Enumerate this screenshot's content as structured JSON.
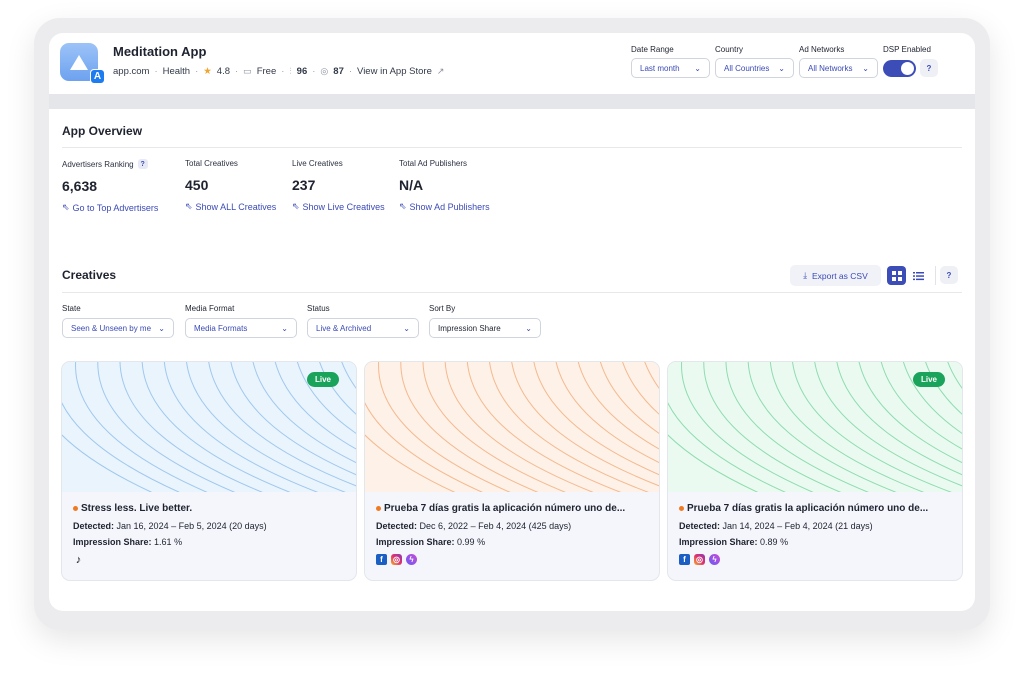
{
  "app": {
    "name": "Meditation App",
    "domain": "app.com",
    "category": "Health",
    "rating": "4.8",
    "price": "Free",
    "stat1": "96",
    "stat2": "87",
    "store_link": "View in App Store"
  },
  "header_filters": {
    "date_range": {
      "label": "Date Range",
      "value": "Last month"
    },
    "country": {
      "label": "Country",
      "value": "All Countries"
    },
    "ad_networks": {
      "label": "Ad Networks",
      "value": "All Networks"
    },
    "dsp": {
      "label": "DSP Enabled",
      "enabled": true,
      "help": "?"
    }
  },
  "overview": {
    "title": "App Overview",
    "stats": [
      {
        "label": "Advertisers Ranking",
        "value": "6,638",
        "link": "Go to Top Advertisers",
        "help": "?"
      },
      {
        "label": "Total Creatives",
        "value": "450",
        "link": "Show ALL Creatives"
      },
      {
        "label": "Live Creatives",
        "value": "237",
        "link": "Show Live Creatives"
      },
      {
        "label": "Total Ad Publishers",
        "value": "N/A",
        "link": "Show Ad Publishers"
      }
    ]
  },
  "creatives": {
    "title": "Creatives",
    "export_label": "Export as CSV",
    "help": "?",
    "filters": [
      {
        "label": "State",
        "value": "Seen & Unseen by me"
      },
      {
        "label": "Media Format",
        "value": "Media Formats"
      },
      {
        "label": "Status",
        "value": "Live & Archived"
      },
      {
        "label": "Sort By",
        "value": "Impression Share"
      }
    ],
    "items": [
      {
        "live_label": "Live",
        "is_live": true,
        "title": "Stress less. Live better.",
        "detected_label": "Detected:",
        "detected_value": "Jan 16, 2024 – Feb 5, 2024 (20 days)",
        "share_label": "Impression Share:",
        "share_value": "1.61 %",
        "networks": [
          "tiktok"
        ],
        "pattern_color": "#9fc8ee",
        "bg_color": "#eaf4fd"
      },
      {
        "live_label": "",
        "is_live": false,
        "title": "Prueba 7 días gratis la aplicación número uno de...",
        "detected_label": "Detected:",
        "detected_value": "Dec 6, 2022 – Feb 4, 2024 (425 days)",
        "share_label": "Impression Share:",
        "share_value": "0.99 %",
        "networks": [
          "facebook",
          "instagram",
          "messenger"
        ],
        "pattern_color": "#f5b98e",
        "bg_color": "#fdf1e8"
      },
      {
        "live_label": "Live",
        "is_live": true,
        "title": "Prueba 7 días gratis la aplicación número uno de...",
        "detected_label": "Detected:",
        "detected_value": "Jan 14, 2024 – Feb 4, 2024 (21 days)",
        "share_label": "Impression Share:",
        "share_value": "0.89 %",
        "networks": [
          "facebook",
          "instagram",
          "messenger"
        ],
        "pattern_color": "#8fdcae",
        "bg_color": "#eafaf1"
      }
    ]
  }
}
